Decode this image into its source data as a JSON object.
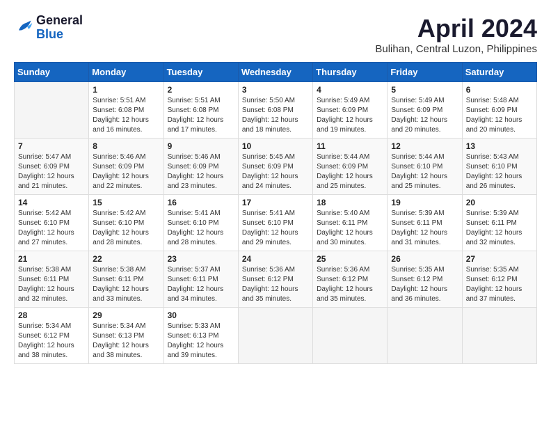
{
  "header": {
    "logo_line1": "General",
    "logo_line2": "Blue",
    "month": "April 2024",
    "location": "Bulihan, Central Luzon, Philippines"
  },
  "weekdays": [
    "Sunday",
    "Monday",
    "Tuesday",
    "Wednesday",
    "Thursday",
    "Friday",
    "Saturday"
  ],
  "weeks": [
    [
      {
        "day": "",
        "info": ""
      },
      {
        "day": "1",
        "info": "Sunrise: 5:51 AM\nSunset: 6:08 PM\nDaylight: 12 hours\nand 16 minutes."
      },
      {
        "day": "2",
        "info": "Sunrise: 5:51 AM\nSunset: 6:08 PM\nDaylight: 12 hours\nand 17 minutes."
      },
      {
        "day": "3",
        "info": "Sunrise: 5:50 AM\nSunset: 6:08 PM\nDaylight: 12 hours\nand 18 minutes."
      },
      {
        "day": "4",
        "info": "Sunrise: 5:49 AM\nSunset: 6:09 PM\nDaylight: 12 hours\nand 19 minutes."
      },
      {
        "day": "5",
        "info": "Sunrise: 5:49 AM\nSunset: 6:09 PM\nDaylight: 12 hours\nand 20 minutes."
      },
      {
        "day": "6",
        "info": "Sunrise: 5:48 AM\nSunset: 6:09 PM\nDaylight: 12 hours\nand 20 minutes."
      }
    ],
    [
      {
        "day": "7",
        "info": "Sunrise: 5:47 AM\nSunset: 6:09 PM\nDaylight: 12 hours\nand 21 minutes."
      },
      {
        "day": "8",
        "info": "Sunrise: 5:46 AM\nSunset: 6:09 PM\nDaylight: 12 hours\nand 22 minutes."
      },
      {
        "day": "9",
        "info": "Sunrise: 5:46 AM\nSunset: 6:09 PM\nDaylight: 12 hours\nand 23 minutes."
      },
      {
        "day": "10",
        "info": "Sunrise: 5:45 AM\nSunset: 6:09 PM\nDaylight: 12 hours\nand 24 minutes."
      },
      {
        "day": "11",
        "info": "Sunrise: 5:44 AM\nSunset: 6:09 PM\nDaylight: 12 hours\nand 25 minutes."
      },
      {
        "day": "12",
        "info": "Sunrise: 5:44 AM\nSunset: 6:10 PM\nDaylight: 12 hours\nand 25 minutes."
      },
      {
        "day": "13",
        "info": "Sunrise: 5:43 AM\nSunset: 6:10 PM\nDaylight: 12 hours\nand 26 minutes."
      }
    ],
    [
      {
        "day": "14",
        "info": "Sunrise: 5:42 AM\nSunset: 6:10 PM\nDaylight: 12 hours\nand 27 minutes."
      },
      {
        "day": "15",
        "info": "Sunrise: 5:42 AM\nSunset: 6:10 PM\nDaylight: 12 hours\nand 28 minutes."
      },
      {
        "day": "16",
        "info": "Sunrise: 5:41 AM\nSunset: 6:10 PM\nDaylight: 12 hours\nand 28 minutes."
      },
      {
        "day": "17",
        "info": "Sunrise: 5:41 AM\nSunset: 6:10 PM\nDaylight: 12 hours\nand 29 minutes."
      },
      {
        "day": "18",
        "info": "Sunrise: 5:40 AM\nSunset: 6:11 PM\nDaylight: 12 hours\nand 30 minutes."
      },
      {
        "day": "19",
        "info": "Sunrise: 5:39 AM\nSunset: 6:11 PM\nDaylight: 12 hours\nand 31 minutes."
      },
      {
        "day": "20",
        "info": "Sunrise: 5:39 AM\nSunset: 6:11 PM\nDaylight: 12 hours\nand 32 minutes."
      }
    ],
    [
      {
        "day": "21",
        "info": "Sunrise: 5:38 AM\nSunset: 6:11 PM\nDaylight: 12 hours\nand 32 minutes."
      },
      {
        "day": "22",
        "info": "Sunrise: 5:38 AM\nSunset: 6:11 PM\nDaylight: 12 hours\nand 33 minutes."
      },
      {
        "day": "23",
        "info": "Sunrise: 5:37 AM\nSunset: 6:11 PM\nDaylight: 12 hours\nand 34 minutes."
      },
      {
        "day": "24",
        "info": "Sunrise: 5:36 AM\nSunset: 6:12 PM\nDaylight: 12 hours\nand 35 minutes."
      },
      {
        "day": "25",
        "info": "Sunrise: 5:36 AM\nSunset: 6:12 PM\nDaylight: 12 hours\nand 35 minutes."
      },
      {
        "day": "26",
        "info": "Sunrise: 5:35 AM\nSunset: 6:12 PM\nDaylight: 12 hours\nand 36 minutes."
      },
      {
        "day": "27",
        "info": "Sunrise: 5:35 AM\nSunset: 6:12 PM\nDaylight: 12 hours\nand 37 minutes."
      }
    ],
    [
      {
        "day": "28",
        "info": "Sunrise: 5:34 AM\nSunset: 6:12 PM\nDaylight: 12 hours\nand 38 minutes."
      },
      {
        "day": "29",
        "info": "Sunrise: 5:34 AM\nSunset: 6:13 PM\nDaylight: 12 hours\nand 38 minutes."
      },
      {
        "day": "30",
        "info": "Sunrise: 5:33 AM\nSunset: 6:13 PM\nDaylight: 12 hours\nand 39 minutes."
      },
      {
        "day": "",
        "info": ""
      },
      {
        "day": "",
        "info": ""
      },
      {
        "day": "",
        "info": ""
      },
      {
        "day": "",
        "info": ""
      }
    ]
  ]
}
